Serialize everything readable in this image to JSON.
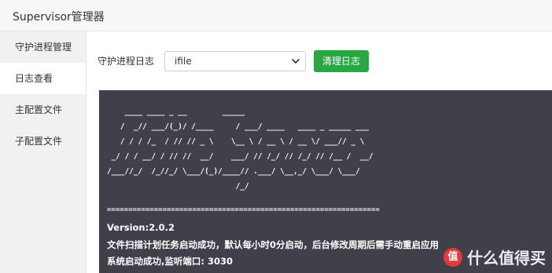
{
  "app": {
    "title": "Supervisor管理器"
  },
  "sidebar": {
    "items": [
      {
        "label": "守护进程管理"
      },
      {
        "label": "日志查看"
      },
      {
        "label": "主配置文件"
      },
      {
        "label": "子配置文件"
      }
    ]
  },
  "toolbar": {
    "log_label": "守护进程日志",
    "selected_log": "ifile",
    "clear_button": "清理日志",
    "accent_color": "#28a745"
  },
  "console": {
    "ascii_art": [
      "    ____ ____ _ __        _____",
      "   /  _// ___/(_)/ /____     / ___/ ____   ____ _ _____ ___",
      "   / / / /_  / // // _ \\    \\__ \\ / __ \\ / __ \\/ ___// _ \\",
      " _/ / / __/ / // //  __/    ___/ // /_/ // /_/ // /__ /  __/",
      "/___//_/  /_//_/ \\___/(_)/____// .___/ \\__,_/ \\___/ \\___/",
      "                             /_/"
    ],
    "separator": "================================================================",
    "lines": [
      "Version:2.0.2",
      "文件扫描计划任务启动成功，默认每小时0分启动，后台修改周期后需手动重启应用",
      "系统启动成功,监听端口: 3030"
    ],
    "background": "#3f4049"
  },
  "watermark": {
    "logo_text": "值",
    "text": "什么值得买"
  }
}
